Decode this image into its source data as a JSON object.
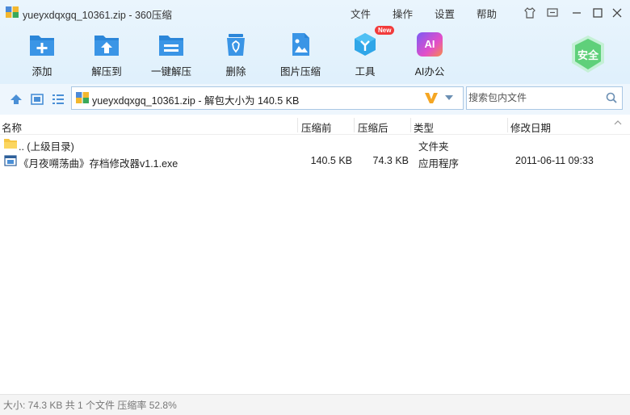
{
  "window": {
    "title": "yueyxdqxgq_10361.zip - 360压缩"
  },
  "menu": [
    "文件",
    "操作",
    "设置",
    "帮助"
  ],
  "toolbar": {
    "items": [
      {
        "label": "添加",
        "icon": "add-archive-icon"
      },
      {
        "label": "解压到",
        "icon": "extract-to-icon"
      },
      {
        "label": "一键解压",
        "icon": "one-click-extract-icon"
      },
      {
        "label": "删除",
        "icon": "delete-icon"
      },
      {
        "label": "图片压缩",
        "icon": "image-compress-icon"
      },
      {
        "label": "工具",
        "icon": "tools-icon",
        "badge": "New"
      },
      {
        "label": "AI办公",
        "icon": "ai-office-icon",
        "icon_text": "AI"
      }
    ],
    "security_label": "安全"
  },
  "address": {
    "path": "yueyxdqxgq_10361.zip - 解包大小为 140.5 KB"
  },
  "search": {
    "placeholder": "搜索包内文件"
  },
  "columns": {
    "name": "名称",
    "before": "压缩前",
    "after": "压缩后",
    "type": "类型",
    "modified": "修改日期"
  },
  "files": [
    {
      "name": ".. (上级目录)",
      "before": "",
      "after": "",
      "type": "文件夹",
      "modified": "",
      "icon": "folder-icon"
    },
    {
      "name": "《月夜嗍荡曲》存档修改器v1.1.exe",
      "before": "140.5 KB",
      "after": "74.3 KB",
      "type": "应用程序",
      "modified": "2011-06-11 09:33",
      "icon": "exe-file-icon"
    }
  ],
  "status": "大小: 74.3 KB 共 1 个文件 压缩率 52.8%",
  "colors": {
    "accent": "#2b86d9",
    "toolbar_bg": "#e4f2fc",
    "security": "#5fd07a"
  }
}
